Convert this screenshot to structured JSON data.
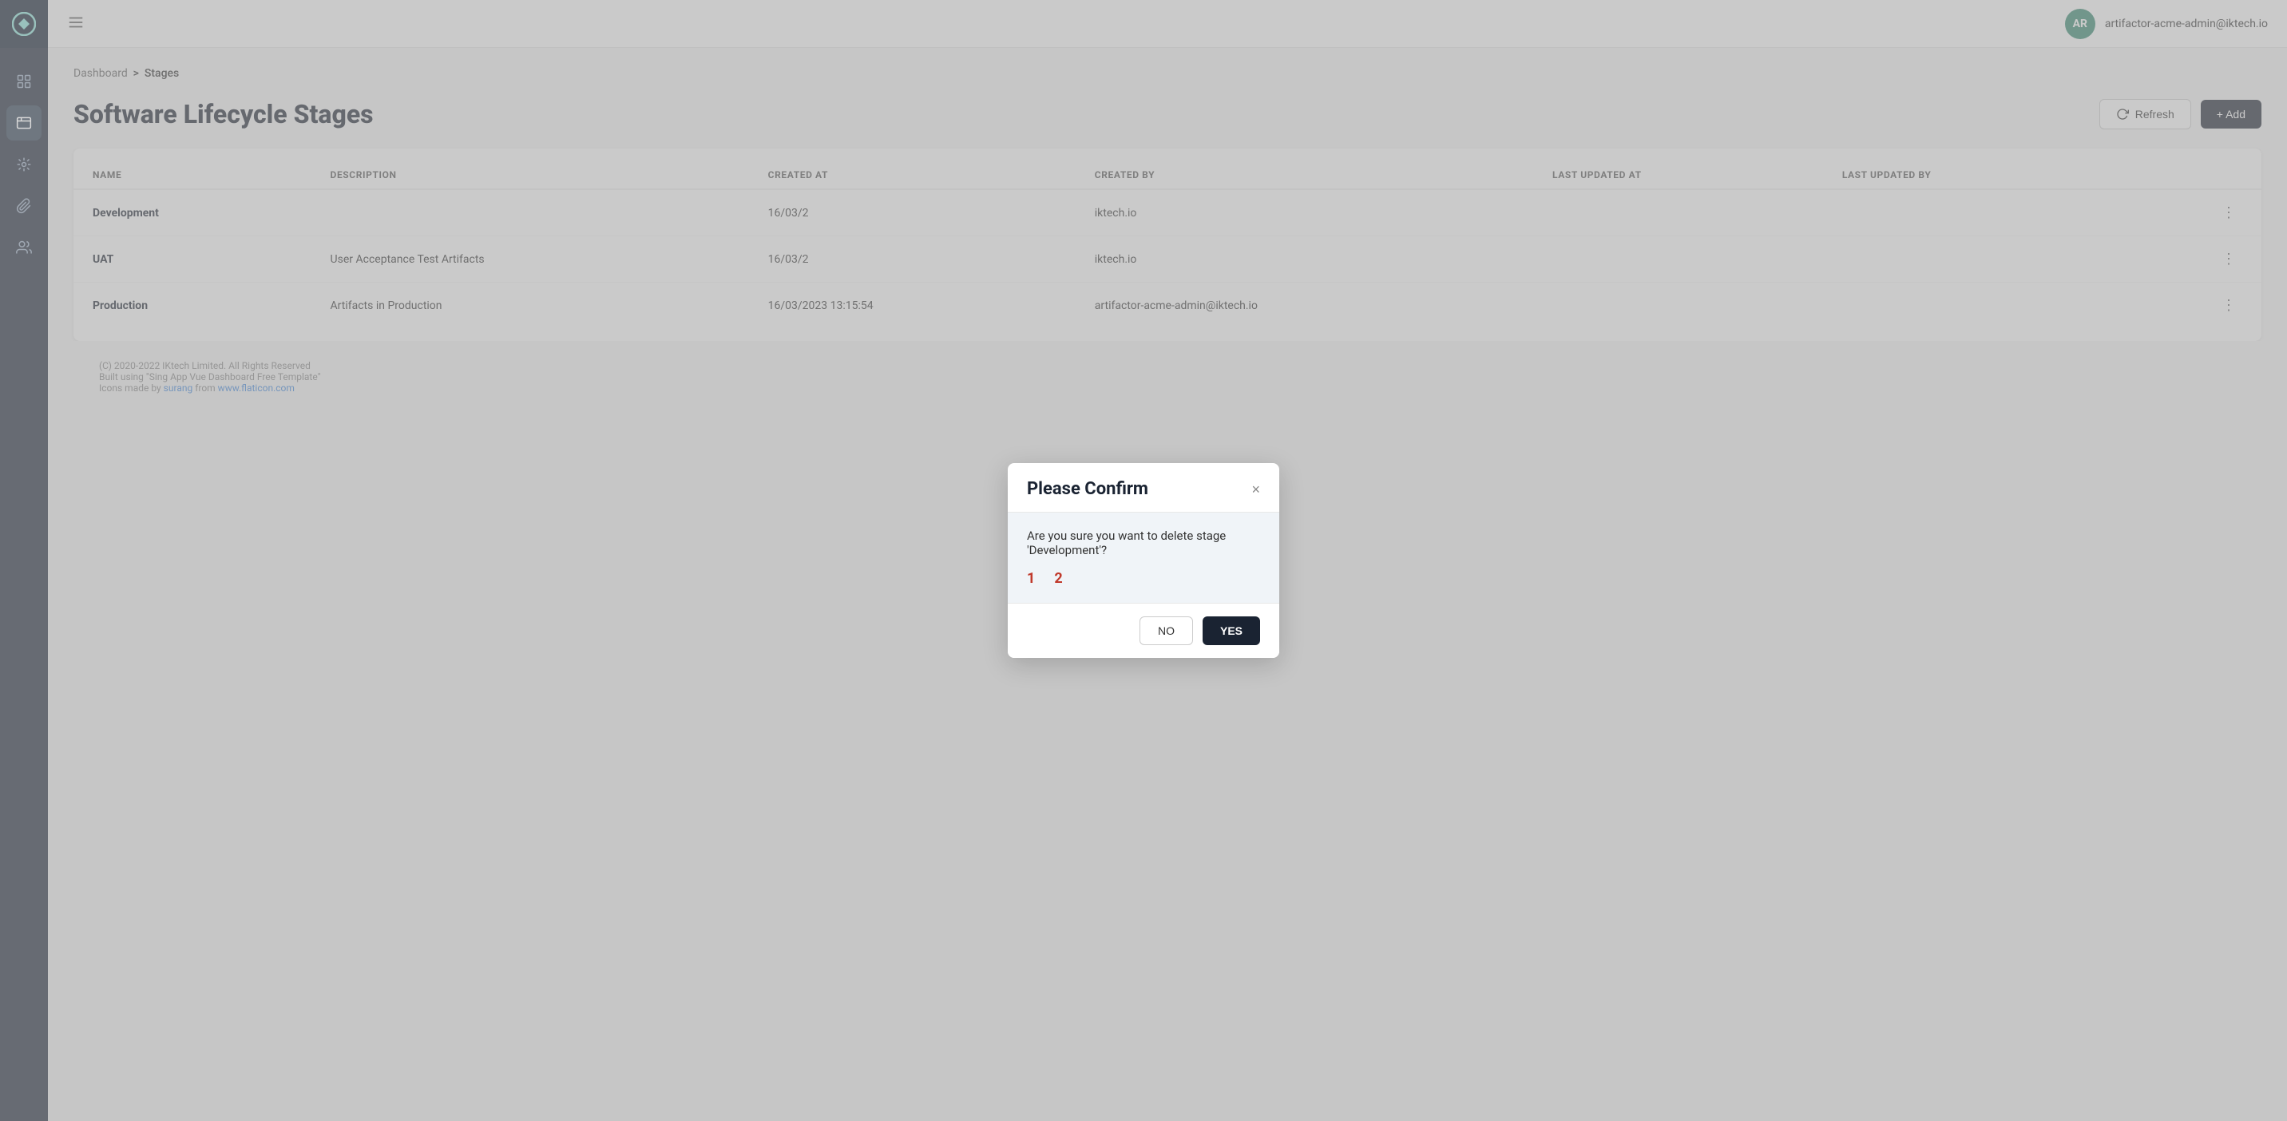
{
  "app": {
    "logo_alt": "App Logo"
  },
  "sidebar": {
    "items": [
      {
        "name": "dashboard",
        "label": "Dashboard",
        "active": false
      },
      {
        "name": "stages",
        "label": "Stages",
        "active": true
      },
      {
        "name": "integrations",
        "label": "Integrations",
        "active": false
      },
      {
        "name": "attachments",
        "label": "Attachments",
        "active": false
      },
      {
        "name": "users",
        "label": "Users",
        "active": false
      }
    ]
  },
  "topbar": {
    "menu_label": "Menu",
    "user_initials": "AR",
    "user_email": "artifactor-acme-admin@iktech.io"
  },
  "breadcrumb": {
    "parent": "Dashboard",
    "separator": ">",
    "current": "Stages"
  },
  "page": {
    "title": "Software Lifecycle Stages",
    "refresh_label": "Refresh",
    "add_label": "+ Add"
  },
  "table": {
    "columns": [
      "NAME",
      "DESCRIPTION",
      "CREATED AT",
      "CREATED BY",
      "LAST UPDATED AT",
      "LAST UPDATED BY"
    ],
    "rows": [
      {
        "name": "Development",
        "description": "",
        "created_at": "16/03/2",
        "created_by": "iktech.io",
        "last_updated_at": "",
        "last_updated_by": ""
      },
      {
        "name": "UAT",
        "description": "User Acceptance Test Artifacts",
        "created_at": "16/03/2",
        "created_by": "iktech.io",
        "last_updated_at": "",
        "last_updated_by": ""
      },
      {
        "name": "Production",
        "description": "Artifacts in Production",
        "created_at": "16/03/2023 13:15:54",
        "created_by": "artifactor-acme-admin@iktech.io",
        "last_updated_at": "",
        "last_updated_by": ""
      }
    ]
  },
  "modal": {
    "title": "Please Confirm",
    "body": "Are you sure you want to delete stage 'Development'?",
    "num1": "1",
    "num2": "2",
    "no_label": "NO",
    "yes_label": "YES"
  },
  "footer": {
    "copyright": "(C) 2020-2022 IKtech Limited. All Rights Reserved",
    "built_using": "Built using \"Sing App Vue Dashboard Free Template\"",
    "icons_prefix": "Icons made by ",
    "icons_author": "surang",
    "icons_suffix": " from ",
    "icons_source": "www.flaticon.com"
  }
}
